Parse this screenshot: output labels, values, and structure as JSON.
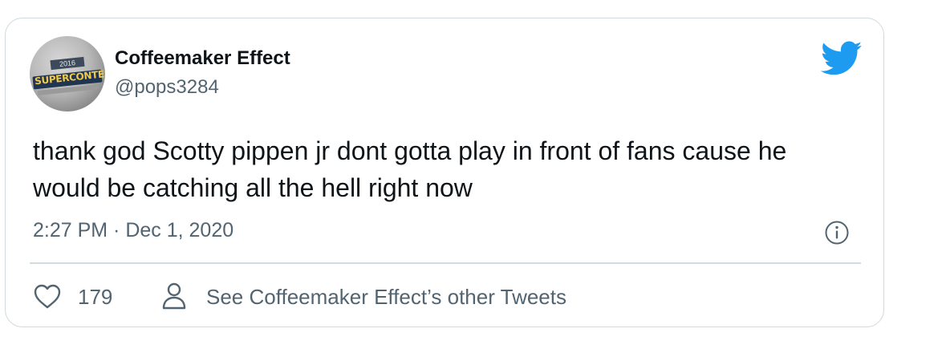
{
  "tweet": {
    "author": {
      "display_name": "Coffeemaker Effect",
      "handle": "@pops3284",
      "avatar_icon": "avatar-image"
    },
    "text": "thank god Scotty pippen jr dont gotta play in front of fans cause he would be catching all the hell right now",
    "timestamp": "2:27 PM · Dec 1, 2020",
    "likes": "179",
    "other_tweets_label": "See Coffeemaker Effect’s other Tweets"
  },
  "avatar_art": {
    "year": "2016",
    "label": "SUPERCONTEST"
  },
  "icons": {
    "brand": "twitter-bird-icon",
    "info": "info-icon",
    "like": "heart-icon",
    "profile": "person-icon"
  },
  "colors": {
    "brand_blue": "#1d9bf0",
    "text_primary": "#0f1419",
    "text_secondary": "#536471",
    "border": "#cfd9de"
  }
}
